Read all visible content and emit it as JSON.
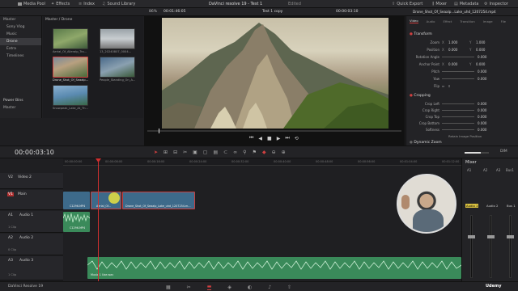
{
  "topbar": {
    "media_pool": "Media Pool",
    "effects": "Effects",
    "index": "Index",
    "sound_library": "Sound Library",
    "title": "DaVinci resolve 19 - Test 1",
    "edited": "Edited",
    "quick_export": "Quick Export",
    "mixer": "Mixer",
    "metadata": "Metadata",
    "inspector": "Inspector"
  },
  "toolbar2": {
    "zoom": "86%",
    "timecode_left": "00:01:46:05",
    "timeline_name": "Test 1 copy",
    "timecode_right": "00:00:03:10",
    "clip_name": "Drone_Shot_Of_Seaalp...Lake_uhd_1207254.mp4"
  },
  "left_panel": {
    "items": [
      "Master",
      "Sony Vlog",
      "Music",
      "Drone",
      "Extra",
      "Timelines"
    ],
    "power_bins": "Power Bins",
    "power_master": "Master"
  },
  "media": {
    "path": "Master / Drone",
    "clips": [
      "Aerial_Of_Alieralp_Tro...",
      "13_20240807_0004...",
      "Drone_Shot_Of_Seaalp...",
      "People_Standing_On_A...",
      "Snowpeak_Lake_At_Th..."
    ]
  },
  "inspector": {
    "tabs": [
      "Video",
      "Audio",
      "Effect",
      "Transition",
      "Image",
      "File"
    ],
    "transform": "Transform",
    "zoom_label": "Zoom",
    "zoom_x": "1.000",
    "zoom_y": "1.000",
    "position_label": "Position",
    "pos_x": "0.000",
    "pos_y": "0.000",
    "rotation_label": "Rotation Angle",
    "rotation": "0.000",
    "anchor_label": "Anchor Point",
    "anchor_x": "0.000",
    "anchor_y": "0.000",
    "pitch_label": "Pitch",
    "pitch": "0.000",
    "yaw_label": "Yaw",
    "yaw": "0.000",
    "flip_label": "Flip",
    "cropping": "Cropping",
    "crop_left": "Crop Left",
    "crop_right": "Crop Right",
    "crop_top": "Crop Top",
    "crop_bottom": "Crop Bottom",
    "softness": "Softness",
    "crop_val": "0.000",
    "retain": "Retain Image Position",
    "dynamic_zoom": "Dynamic Zoom"
  },
  "timeline": {
    "timecode": "00:00:03:10",
    "ruler": [
      "00:00:00:00",
      "00:00:08:00",
      "00:00:16:00",
      "00:00:24:00",
      "00:00:32:00",
      "00:00:40:00",
      "00:00:48:00",
      "00:00:56:00",
      "00:01:04:00",
      "00:01:12:00"
    ],
    "tracks": [
      {
        "id": "V2",
        "name": "Video 2"
      },
      {
        "id": "V1",
        "name": "Main"
      },
      {
        "id": "A1",
        "name": "Audio 1",
        "info": "1 Clip"
      },
      {
        "id": "A2",
        "name": "Audio 2",
        "info": "0 Clip"
      },
      {
        "id": "A3",
        "name": "Audio 3",
        "info": "1 Clip"
      }
    ],
    "clips": {
      "v1a": "C1296.MP4",
      "v1b": "Aerial_Of...",
      "v1c": "Drone_Shot_Of_Seaalp_Lake_uhd_1207254.m...",
      "a1": "C1296.MP4",
      "a3": "Music 1 Use.wav"
    }
  },
  "mixer": {
    "title": "Mixer",
    "ch": [
      "A1",
      "A2",
      "A3",
      "Bus1"
    ],
    "labels": [
      "Audio 1",
      "Audio 2",
      "Audio 3",
      "Bus 1"
    ]
  },
  "bottom": {
    "app": "DaVinci Resolve 19"
  },
  "watermark": "Udemy"
}
